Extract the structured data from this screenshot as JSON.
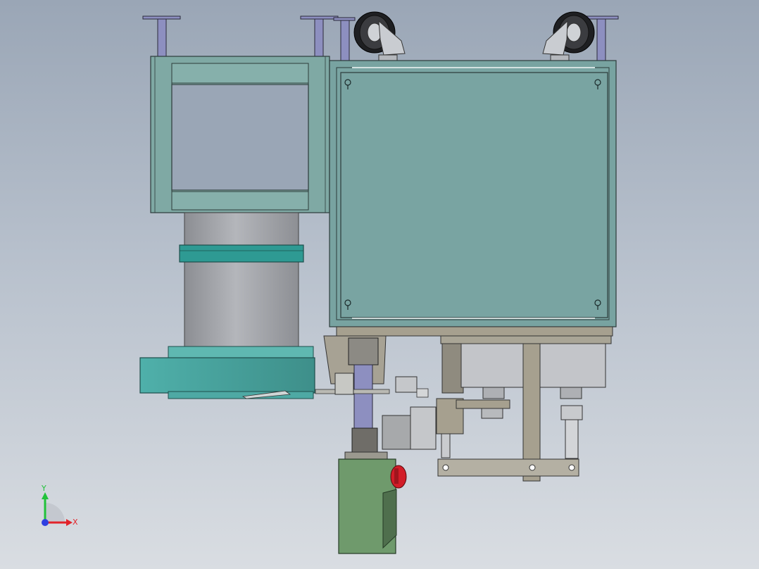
{
  "viewport": {
    "background_top": "#9aa6b6",
    "background_bottom": "#d9dde2"
  },
  "colors": {
    "frame_teal": "#7fa9a4",
    "cabinet_teal": "#78a3a1",
    "cylinder_gray": "#a3a5aa",
    "band_teal": "#2e9a93",
    "base_teal": "#4ea9a4",
    "control_box_green": "#6f9a6c",
    "estop_red": "#d21d28",
    "wheel_black": "#1e1f22",
    "post_purple": "#8d8fc0",
    "steel_gray": "#9fa3a8"
  },
  "triad": {
    "y_label": "Y",
    "x_label": "X",
    "y_color": "#21c23a",
    "x_color": "#e2232a",
    "z_color": "#2f3fe0"
  }
}
